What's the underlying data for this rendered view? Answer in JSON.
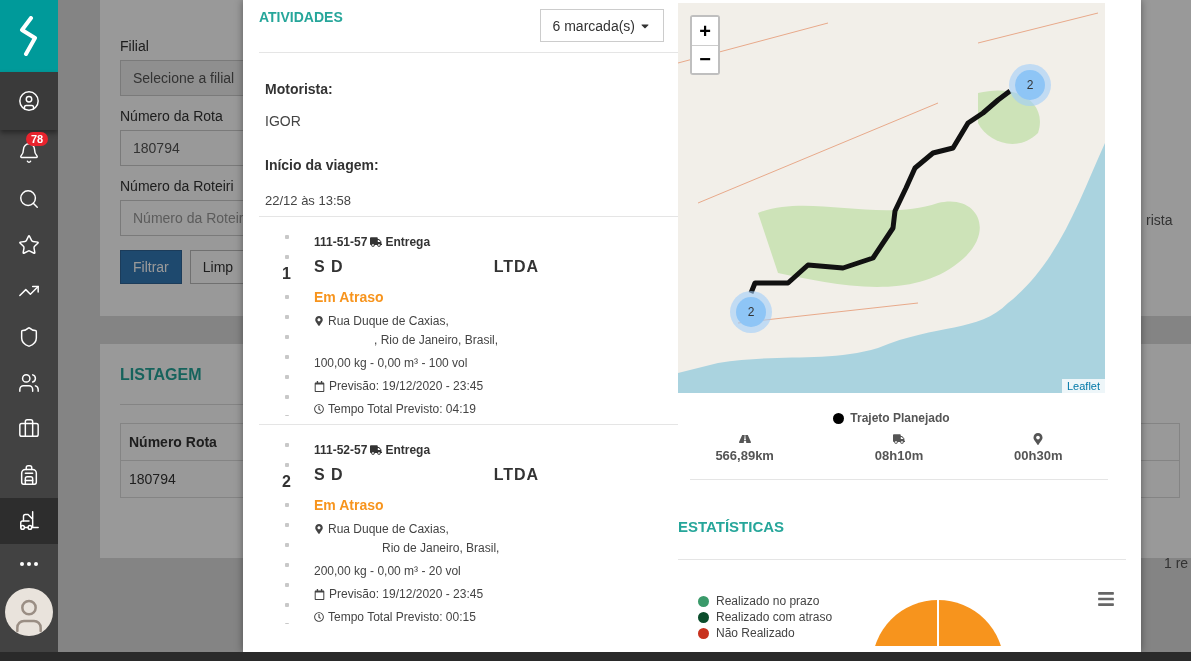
{
  "sidebar": {
    "items": [
      {
        "selected": false
      },
      {
        "selected": false,
        "badge": "78"
      },
      {
        "selected": false
      },
      {
        "selected": false
      },
      {
        "selected": false
      },
      {
        "selected": false
      },
      {
        "selected": false
      },
      {
        "selected": false
      },
      {
        "selected": false
      },
      {
        "selected": true
      },
      {
        "selected": false
      }
    ]
  },
  "filter_form": {
    "fields": [
      {
        "label": "Filial",
        "value": "Selecione a filial",
        "kind": "select"
      },
      {
        "label": "Número da Rota",
        "value": "180794",
        "kind": "input"
      },
      {
        "label": "Número da Roteiri",
        "placeholder": "Número da Roteir",
        "kind": "input"
      }
    ],
    "buttons": [
      {
        "label": "Filtrar",
        "primary": true
      },
      {
        "label": "Limp",
        "primary": false
      }
    ],
    "right_fragment": "rista"
  },
  "listing": {
    "title": "LISTAGEM",
    "columns": [
      "Número Rota"
    ],
    "rows": [
      [
        "180794"
      ]
    ],
    "footer_fragment": "1 re"
  },
  "modal": {
    "activities": {
      "title": "ATIVIDADES",
      "filter_button": "6 marcada(s)",
      "driver_label": "Motorista:",
      "driver": "IGOR",
      "start_label": "Início da viagem:",
      "start": "22/12 às 13:58",
      "items": [
        {
          "number": "1",
          "code": "111-51-57",
          "type": "Entrega",
          "name": "S D",
          "name_suffix": "LTDA",
          "status": "Em Atraso",
          "address_line_1": "Rua Duque de Caxias,",
          "address_line_2": ", Rio de Janeiro, Brasil,",
          "load": "100,00 kg - 0,00 m³ - 100 vol",
          "forecast": "Previsão: 19/12/2020 - 23:45",
          "total_time": "Tempo Total Previsto: 04:19"
        },
        {
          "number": "2",
          "code": "111-52-57",
          "type": "Entrega",
          "name": "S D",
          "name_suffix": "LTDA",
          "status": "Em Atraso",
          "address_line_1": "Rua Duque de Caxias,",
          "address_line_2": "Rio de Janeiro, Brasil,",
          "load": "200,00 kg - 0,00 m³ - 20 vol",
          "forecast": "Previsão: 19/12/2020 - 23:45",
          "total_time": "Tempo Total Previsto: 00:15"
        }
      ]
    },
    "map": {
      "zoom_in": "+",
      "zoom_out": "−",
      "clusters": [
        "2",
        "2"
      ],
      "attribution": "Leaflet"
    },
    "route_legend": "Trajeto Planejado",
    "route_stats": [
      {
        "kind": "distance",
        "value": "566,89km"
      },
      {
        "kind": "driving",
        "value": "08h10m"
      },
      {
        "kind": "stop",
        "value": "00h30m"
      }
    ],
    "statistics": {
      "title": "ESTATÍSTICAS",
      "legend": [
        {
          "label": "Realizado no prazo",
          "color": "#3a9a6a"
        },
        {
          "label": "Realizado com atraso",
          "color": "#0b4d2c"
        },
        {
          "label": "Não Realizado",
          "color": "#c8321e"
        }
      ]
    }
  }
}
